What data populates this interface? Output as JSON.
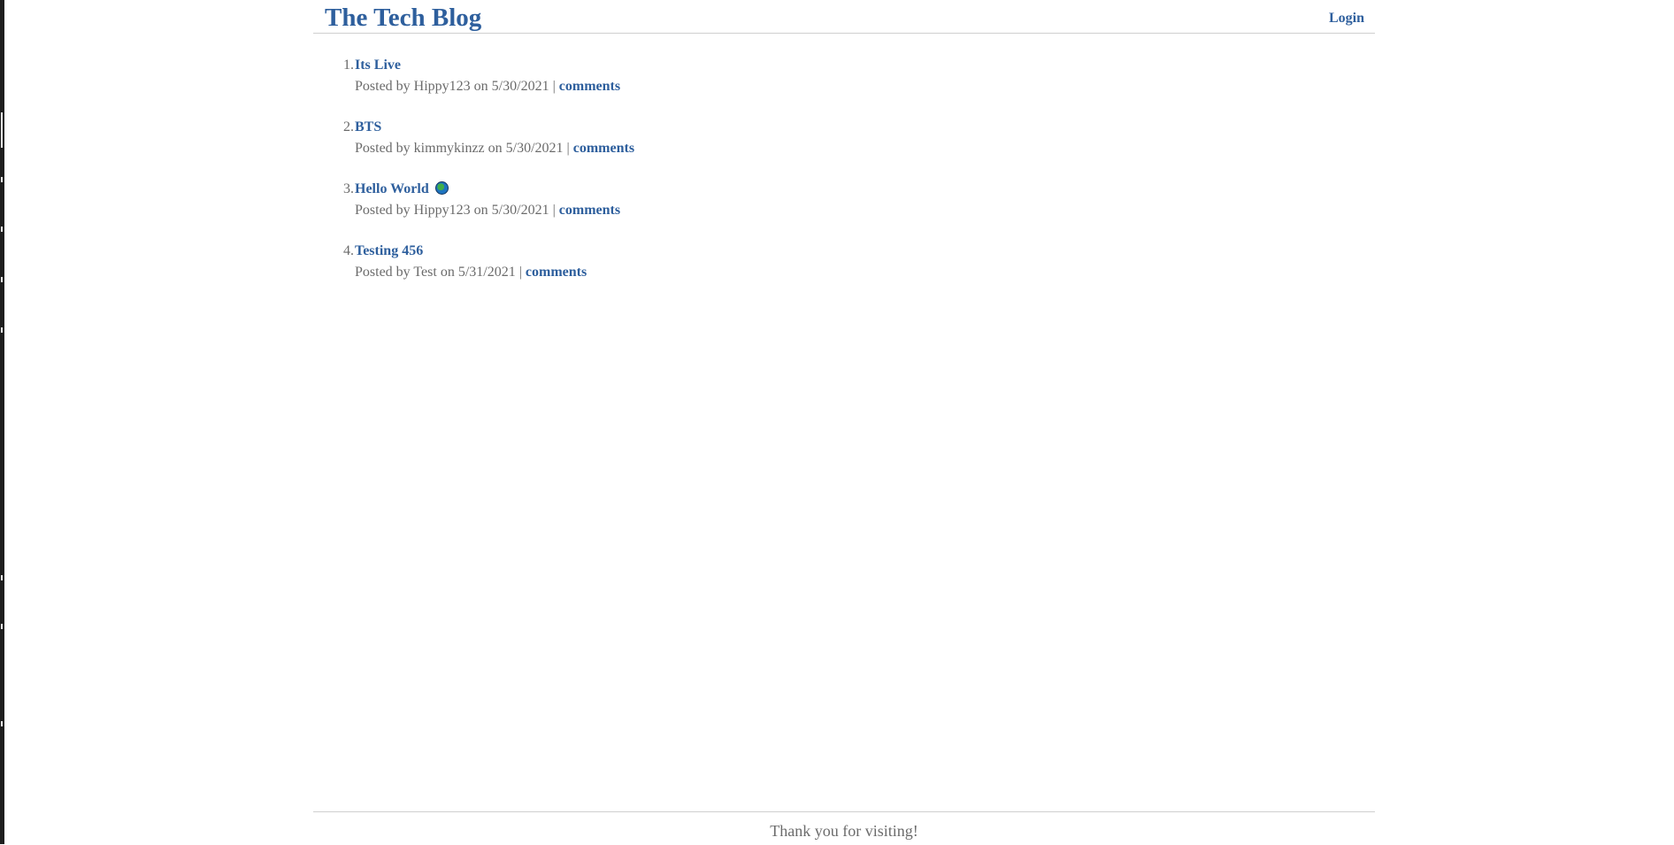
{
  "header": {
    "title": "The Tech Blog",
    "login_label": "Login"
  },
  "posts": [
    {
      "number": "1.",
      "title": "Its Live",
      "author": "Hippy123",
      "date": "5/30/2021",
      "comments_label": "comments"
    },
    {
      "number": "2.",
      "title": "BTS",
      "author": "kimmykinzz",
      "date": "5/30/2021",
      "comments_label": "comments"
    },
    {
      "number": "3.",
      "title": "Hello World",
      "title_icon": "globe-icon",
      "author": "Hippy123",
      "date": "5/30/2021",
      "comments_label": "comments"
    },
    {
      "number": "4.",
      "title": "Testing 456",
      "author": "Test",
      "date": "5/31/2021",
      "comments_label": "comments"
    }
  ],
  "meta_text": {
    "posted_by": "Posted by",
    "on": "on",
    "separator": "|"
  },
  "footer": {
    "text": "Thank you for visiting!"
  },
  "colors": {
    "link": "#2e5f9d",
    "text": "#6b6b6b",
    "rule": "#cfcfcf"
  }
}
